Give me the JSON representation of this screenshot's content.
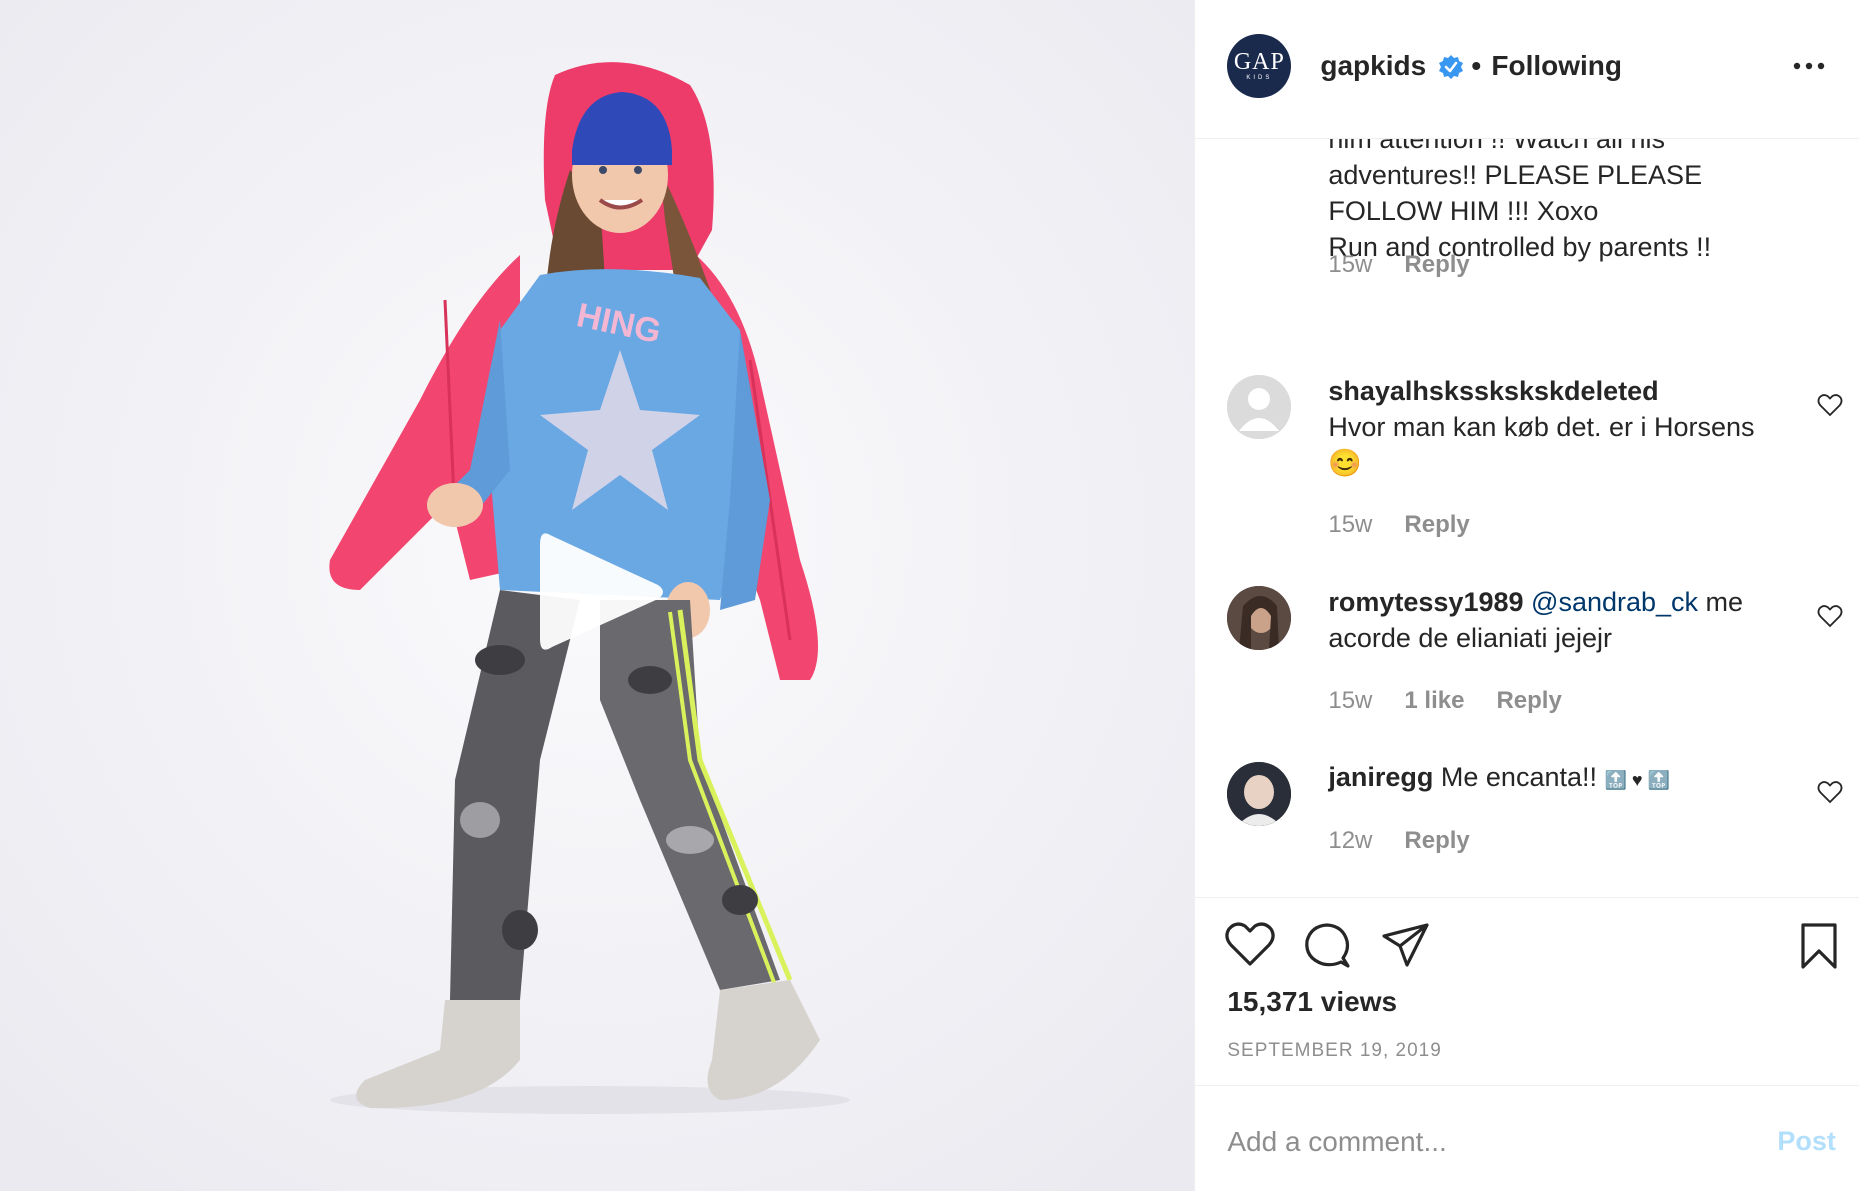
{
  "post": {
    "username": "gapkids",
    "follow_status": "Following",
    "separator": "•",
    "avatar_logo": "GAP",
    "avatar_sub": "KIDS"
  },
  "comments": [
    {
      "lines": [
        "him attention !! Watch all his",
        "adventures!! PLEASE PLEASE",
        "FOLLOW HIM !!! Xoxo",
        "Run and controlled by parents !!"
      ],
      "time": "15w",
      "reply": "Reply"
    },
    {
      "username": "shayalhsksskskskdeleted",
      "username_full": "shayalhsksskskskdeleted",
      "text_line1": "Hvor man kan køb det. er i Horsens",
      "emoji": "😊",
      "time": "15w",
      "reply": "Reply"
    },
    {
      "username": "romytessy1989",
      "mention": "@sandrab_ck",
      "text_tail": "me",
      "text_line2": "acorde de elianiati jejejr",
      "time": "15w",
      "likes": "1 like",
      "reply": "Reply"
    },
    {
      "username": "janiregg",
      "text": "Me encanta!!",
      "emoji_tail": "🔝 ♥ 🔝",
      "time": "12w",
      "reply": "Reply"
    }
  ],
  "stats": {
    "views": "15,371 views",
    "date": "SEPTEMBER 19, 2019"
  },
  "composer": {
    "placeholder": "Add a comment...",
    "post_label": "Post"
  },
  "colors": {
    "accent_blue": "#0095f6",
    "post_disabled": "#b2dffc",
    "mention": "#00376b",
    "muted": "#8e8e8e"
  },
  "icons": [
    "play-icon",
    "verified-icon",
    "more-icon",
    "heart-icon",
    "comment-icon",
    "share-icon",
    "bookmark-icon"
  ]
}
